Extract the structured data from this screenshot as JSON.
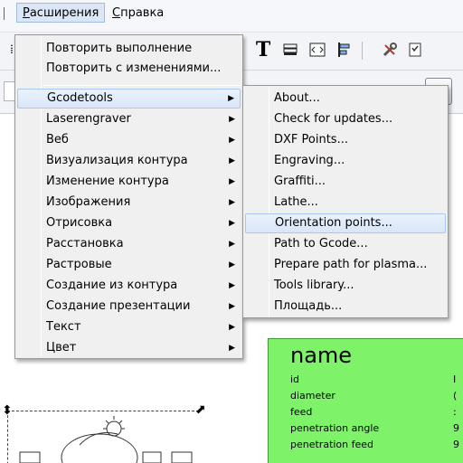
{
  "menubar": {
    "items": [
      {
        "label": "Расширения",
        "accel_first": "Р",
        "rest": "асширения"
      },
      {
        "label": "Справка",
        "accel_first": "С",
        "rest": "правка"
      }
    ]
  },
  "main_menu": {
    "top_items": [
      {
        "label": "Повторить выполнение"
      },
      {
        "label": "Повторить с изменениями..."
      }
    ],
    "items": [
      {
        "label": "Gcodetools"
      },
      {
        "label": "Laserengraver"
      },
      {
        "label": "Веб"
      },
      {
        "label": "Визуализация контура"
      },
      {
        "label": "Изменение контура"
      },
      {
        "label": "Изображения"
      },
      {
        "label": "Отрисовка"
      },
      {
        "label": "Расстановка"
      },
      {
        "label": "Растровые"
      },
      {
        "label": "Создание из контура"
      },
      {
        "label": "Создание презентации"
      },
      {
        "label": "Текст"
      },
      {
        "label": "Цвет"
      }
    ]
  },
  "submenu": {
    "items": [
      {
        "label": "About..."
      },
      {
        "label": "Check for updates..."
      },
      {
        "label": "DXF Points..."
      },
      {
        "label": "Engraving..."
      },
      {
        "label": "Graffiti..."
      },
      {
        "label": "Lathe..."
      },
      {
        "label": "Orientation points..."
      },
      {
        "label": "Path to Gcode..."
      },
      {
        "label": "Prepare path for plasma..."
      },
      {
        "label": "Tools library..."
      },
      {
        "label": "Площадь..."
      }
    ]
  },
  "toolbar": {
    "text_tool_glyph": "T"
  },
  "green_table": {
    "title": "name",
    "rows": [
      {
        "label": "id",
        "value": "I"
      },
      {
        "label": "diameter",
        "value": "("
      },
      {
        "label": "feed",
        "value": ":"
      },
      {
        "label": "penetration angle",
        "value": "9"
      },
      {
        "label": "penetration feed",
        "value": "9"
      }
    ]
  }
}
